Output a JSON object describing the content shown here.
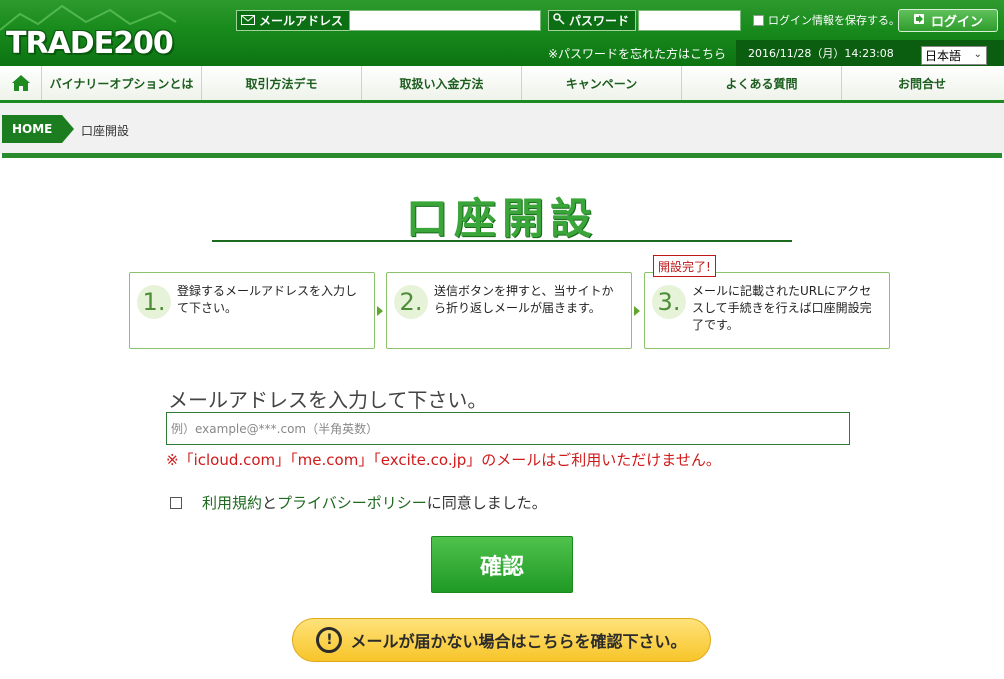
{
  "header": {
    "logo": "TRADE200",
    "email_label": "メールアドレス",
    "password_label": "パスワード",
    "save_login": "ログイン情報を保存する。",
    "login_button": "ログイン",
    "forgot_password": "※パスワードを忘れた方はこちら",
    "datetime": "2016/11/28（月）14:23:08",
    "language": "日本語"
  },
  "nav": {
    "items": [
      {
        "label": "バイナリーオプションとは"
      },
      {
        "label": "取引方法デモ"
      },
      {
        "label": "取扱い入金方法"
      },
      {
        "label": "キャンペーン"
      },
      {
        "label": "よくある質問"
      },
      {
        "label": "お問合せ"
      }
    ]
  },
  "breadcrumb": {
    "home": "HOME",
    "current": "口座開設"
  },
  "page": {
    "title": "口座開設",
    "steps": [
      {
        "num": "1.",
        "text": "登録するメールアドレスを入力して下さい。"
      },
      {
        "num": "2.",
        "text": "送信ボタンを押すと、当サイトから折り返しメールが届きます。"
      },
      {
        "num": "3.",
        "text": "メールに記載されたURLにアクセスして手続きを行えば口座開設完了です。"
      }
    ],
    "complete_badge": "開設完了!",
    "email_prompt": "メールアドレスを入力して下さい。",
    "email_placeholder": "例）example@***.com（半角英数）",
    "warning": "※「icloud.com」「me.com」「excite.co.jp」のメールはご利用いただけません。",
    "agree_terms": "利用規約",
    "agree_and": "と",
    "agree_privacy": "プライバシーポリシー",
    "agree_suffix": "に同意しました。",
    "confirm_button": "確認",
    "help_button": "メールが届かない場合はこちらを確認下さい。"
  }
}
